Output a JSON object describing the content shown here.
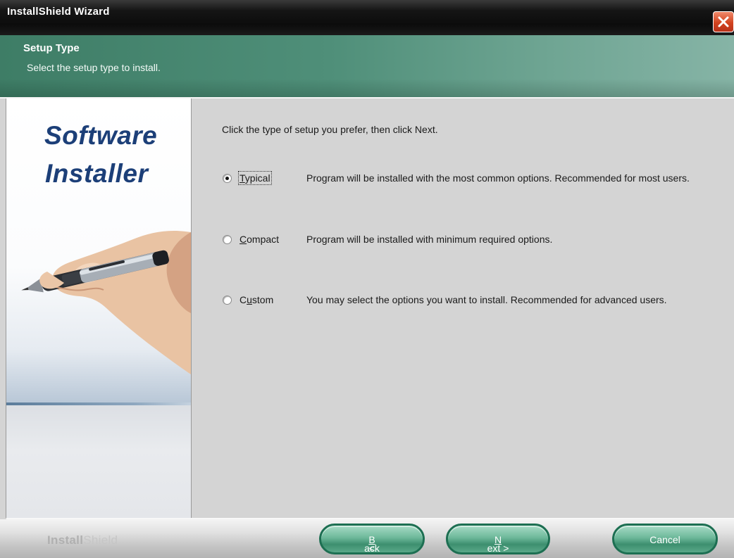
{
  "window": {
    "title": "InstallShield Wizard"
  },
  "header": {
    "title": "Setup Type",
    "subtitle": "Select the setup type to install."
  },
  "left_panel": {
    "brand_line1": "Software",
    "brand_line2": "Installer"
  },
  "main": {
    "instructions": "Click the type of setup you prefer, then click Next.",
    "options": [
      {
        "pre": "",
        "mnemonic": "T",
        "post": "ypical",
        "description": "Program will be installed with the most common options.  Recommended for most users.",
        "selected": true
      },
      {
        "pre": "",
        "mnemonic": "C",
        "post": "ompact",
        "description": "Program will be installed with minimum required options.",
        "selected": false
      },
      {
        "pre": "C",
        "mnemonic": "u",
        "post": "stom",
        "description": "You may select the options you want to install. Recommended for advanced users.",
        "selected": false
      }
    ]
  },
  "footer": {
    "logo_bold": "Install",
    "logo_light": "Shield",
    "back": {
      "pre": "< ",
      "mnemonic": "B",
      "post": "ack"
    },
    "next": {
      "pre": "",
      "mnemonic": "N",
      "post": "ext >"
    },
    "cancel": "Cancel"
  },
  "colors": {
    "title_bar": "#111111",
    "header_green": "#4f8f79",
    "brand_blue": "#1c3f78",
    "button_green": "#3d8f6f",
    "close_red": "#d2431f"
  }
}
